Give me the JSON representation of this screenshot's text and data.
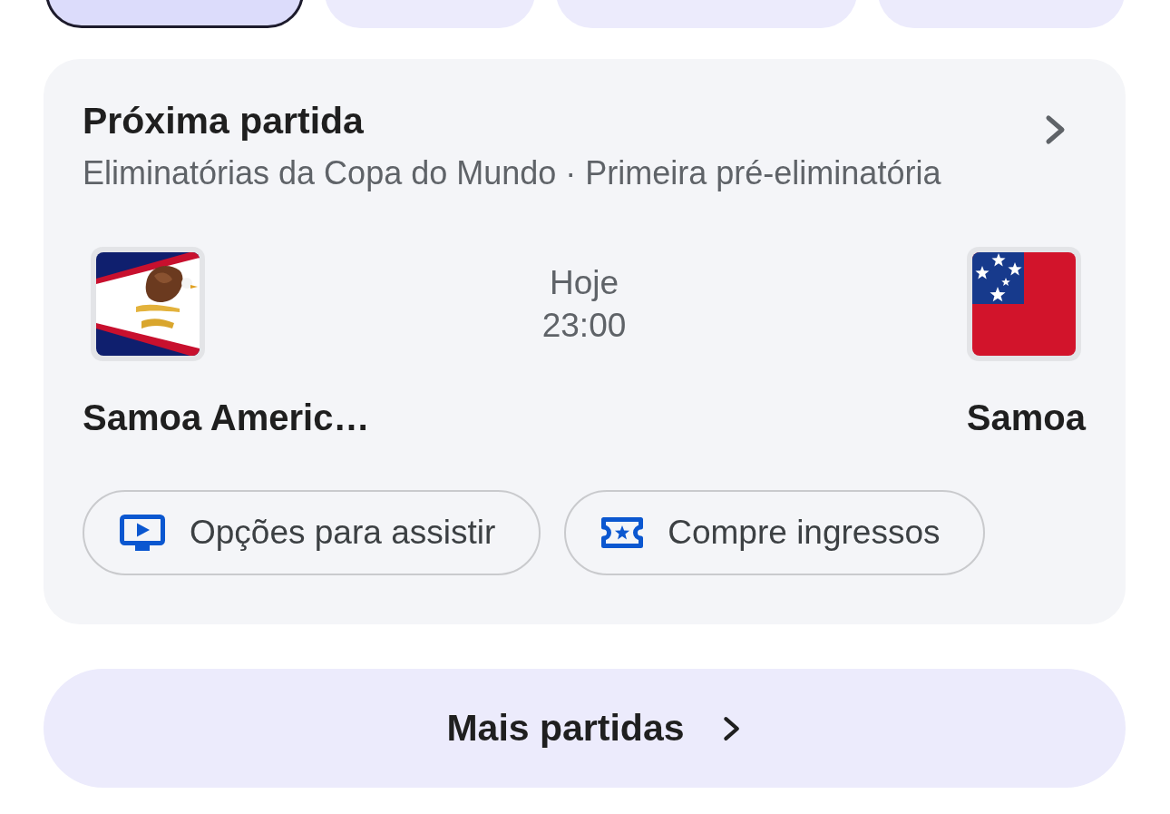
{
  "filter_chips": [
    {
      "selected": true
    },
    {
      "selected": false
    },
    {
      "selected": false
    },
    {
      "selected": false
    }
  ],
  "next_match": {
    "title": "Próxima partida",
    "subtitle": "Eliminatórias da Copa do Mundo · Primeira pré-eliminatória",
    "home_team": {
      "name": "Samoa Americ…"
    },
    "day": "Hoje",
    "time": "23:00",
    "away_team": {
      "name": "Samoa"
    },
    "actions": [
      {
        "kind": "watch",
        "label": "Opções para assistir"
      },
      {
        "kind": "tickets",
        "label": "Compre ingressos"
      }
    ]
  },
  "more_button": {
    "label": "Mais partidas"
  }
}
